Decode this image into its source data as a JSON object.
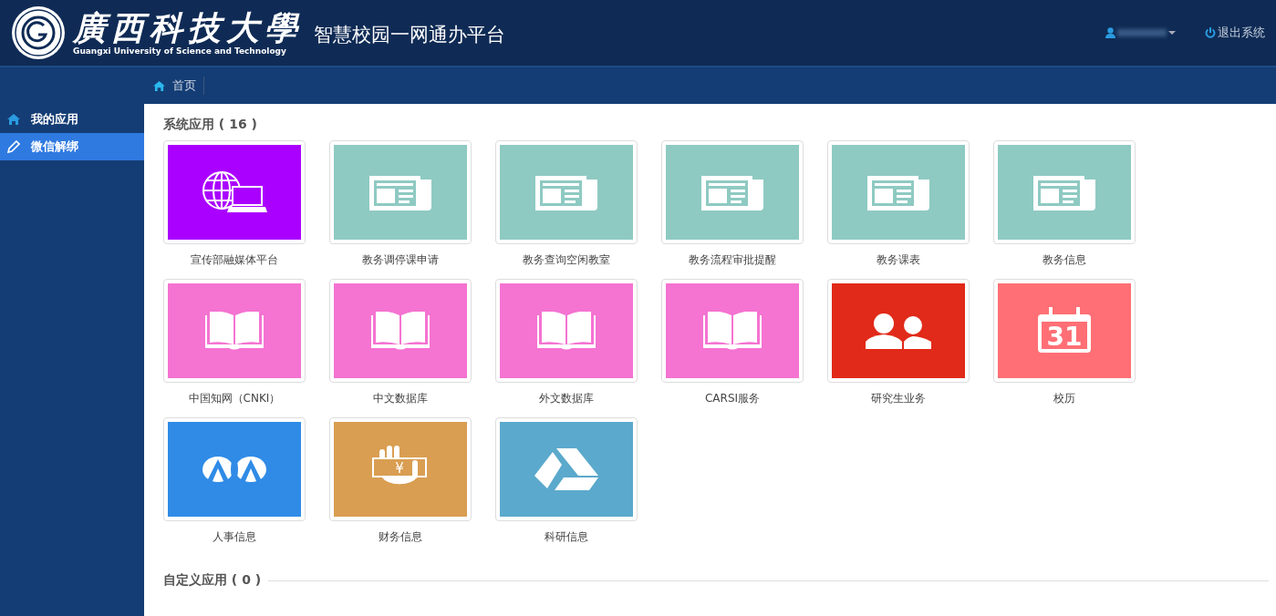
{
  "header": {
    "logo_text": "廣西科技大學",
    "logo_subtitle": "Guangxi University of Science and Technology",
    "platform_title": "智慧校园一网通办平台",
    "logout": "退出系统"
  },
  "breadcrumb": {
    "label": "首页"
  },
  "sidebar": {
    "items": [
      {
        "label": "我的应用",
        "kind": "home",
        "selected": false
      },
      {
        "label": "微信解绑",
        "kind": "pencil",
        "selected": true
      }
    ]
  },
  "system_apps": {
    "title": "系统应用 ( 16 )",
    "apps": [
      {
        "label": "宣传部融媒体平台",
        "kind": "globe",
        "color": "#aa00ff"
      },
      {
        "label": "教务调停课申请",
        "kind": "newspaper",
        "color": "#8ecac2"
      },
      {
        "label": "教务查询空闲教室",
        "kind": "newspaper",
        "color": "#8ecac2"
      },
      {
        "label": "教务流程审批提醒",
        "kind": "newspaper",
        "color": "#8ecac2"
      },
      {
        "label": "教务课表",
        "kind": "newspaper",
        "color": "#8ecac2"
      },
      {
        "label": "教务信息",
        "kind": "newspaper",
        "color": "#8ecac2"
      },
      {
        "label": "中国知网（CNKI）",
        "kind": "book",
        "color": "#f573d1"
      },
      {
        "label": "中文数据库",
        "kind": "book",
        "color": "#f573d1"
      },
      {
        "label": "外文数据库",
        "kind": "book",
        "color": "#f573d1"
      },
      {
        "label": "CARSI服务",
        "kind": "book",
        "color": "#f573d1"
      },
      {
        "label": "研究生业务",
        "kind": "people",
        "color": "#e12a19"
      },
      {
        "label": "校历",
        "kind": "calendar",
        "color": "#ff6f75",
        "icon_text": "31"
      },
      {
        "label": "人事信息",
        "kind": "emblem",
        "color": "#2f8be6"
      },
      {
        "label": "财务信息",
        "kind": "money",
        "color": "#d99e52",
        "icon_text": "¥"
      },
      {
        "label": "科研信息",
        "kind": "drive",
        "color": "#5ba9cc"
      }
    ]
  },
  "custom_apps": {
    "title": "自定义应用 ( 0 )"
  }
}
